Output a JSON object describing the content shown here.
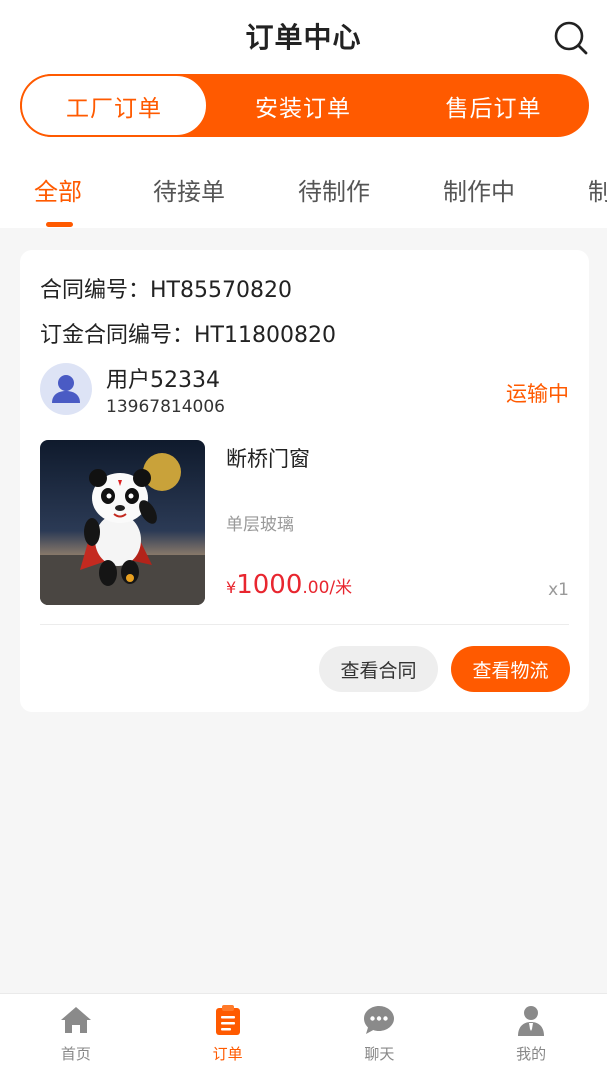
{
  "header": {
    "title": "订单中心"
  },
  "segments": [
    {
      "label": "工厂订单",
      "active": true
    },
    {
      "label": "安装订单",
      "active": false
    },
    {
      "label": "售后订单",
      "active": false
    }
  ],
  "tabs": [
    {
      "label": "全部",
      "active": true
    },
    {
      "label": "待接单",
      "active": false
    },
    {
      "label": "待制作",
      "active": false
    },
    {
      "label": "制作中",
      "active": false
    },
    {
      "label": "制",
      "active": false
    }
  ],
  "order": {
    "contract_no": "合同编号：HT85570820",
    "deposit_contract_no": "订金合同编号：HT11800820",
    "user_name": "用户52334",
    "user_phone": "13967814006",
    "status": "运输中",
    "product_name": "断桥门窗",
    "product_spec": "单层玻璃",
    "price_currency": "¥",
    "price_int": "1000",
    "price_dec": ".00",
    "price_unit": "/米",
    "quantity": "x1",
    "buttons": {
      "view_contract": "查看合同",
      "view_logistics": "查看物流"
    }
  },
  "bottom_nav": [
    {
      "label": "首页",
      "icon": "home-icon",
      "active": false
    },
    {
      "label": "订单",
      "icon": "order-icon",
      "active": true
    },
    {
      "label": "聊天",
      "icon": "chat-icon",
      "active": false
    },
    {
      "label": "我的",
      "icon": "profile-icon",
      "active": false
    }
  ],
  "colors": {
    "accent": "#ff5a00",
    "price": "#e8262f",
    "background": "#f6f6f6"
  }
}
